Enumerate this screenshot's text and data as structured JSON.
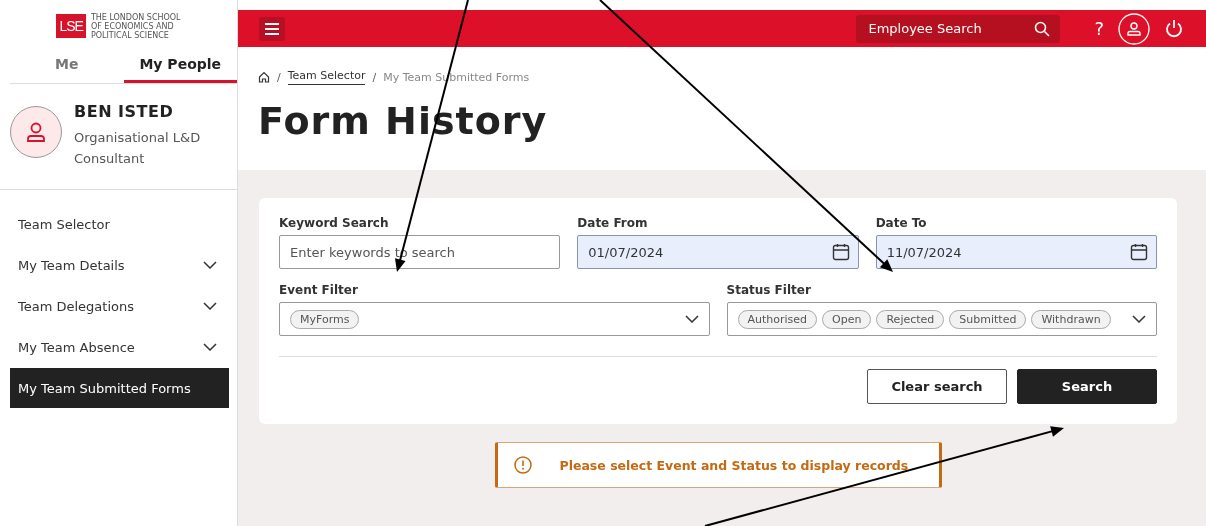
{
  "logo": {
    "mark": "LSE",
    "lines": [
      "THE LONDON SCHOOL",
      "OF ECONOMICS AND",
      "POLITICAL SCIENCE"
    ]
  },
  "sidebar": {
    "tabs": [
      {
        "label": "Me",
        "selected": false
      },
      {
        "label": "My People",
        "selected": true
      }
    ],
    "profile": {
      "name": "BEN ISTED",
      "role": "Organisational L&D Consultant"
    },
    "items": [
      {
        "label": "Team Selector",
        "kind": "link",
        "selected": false
      },
      {
        "label": "My Team Details",
        "kind": "group",
        "selected": false
      },
      {
        "label": "Team Delegations",
        "kind": "group",
        "selected": false
      },
      {
        "label": "My Team Absence",
        "kind": "group",
        "selected": false
      },
      {
        "label": "My Team Submitted Forms",
        "kind": "link",
        "selected": true
      }
    ]
  },
  "header": {
    "search": {
      "placeholder": "Employee Search"
    },
    "help": "?"
  },
  "breadcrumb_separator": "/",
  "breadcrumb": [
    {
      "label": "Team Selector",
      "kind": "link"
    },
    {
      "label": "My Team Submitted Forms",
      "kind": "current"
    }
  ],
  "title": "Form History",
  "filters": {
    "keyword": {
      "label": "Keyword Search",
      "placeholder": "Enter keywords to search"
    },
    "date_from": {
      "label": "Date From",
      "value": "01/07/2024"
    },
    "date_to": {
      "label": "Date To",
      "value": "11/07/2024"
    },
    "event": {
      "label": "Event Filter",
      "chips": [
        "MyForms"
      ]
    },
    "status": {
      "label": "Status Filter",
      "chips": [
        "Authorised",
        "Open",
        "Rejected",
        "Submitted",
        "Withdrawn"
      ]
    }
  },
  "buttons": [
    {
      "label": "Clear search",
      "kind": "secondary"
    },
    {
      "label": "Search",
      "kind": "primary"
    }
  ],
  "alert": {
    "message": "Please select Event and Status to display records"
  }
}
